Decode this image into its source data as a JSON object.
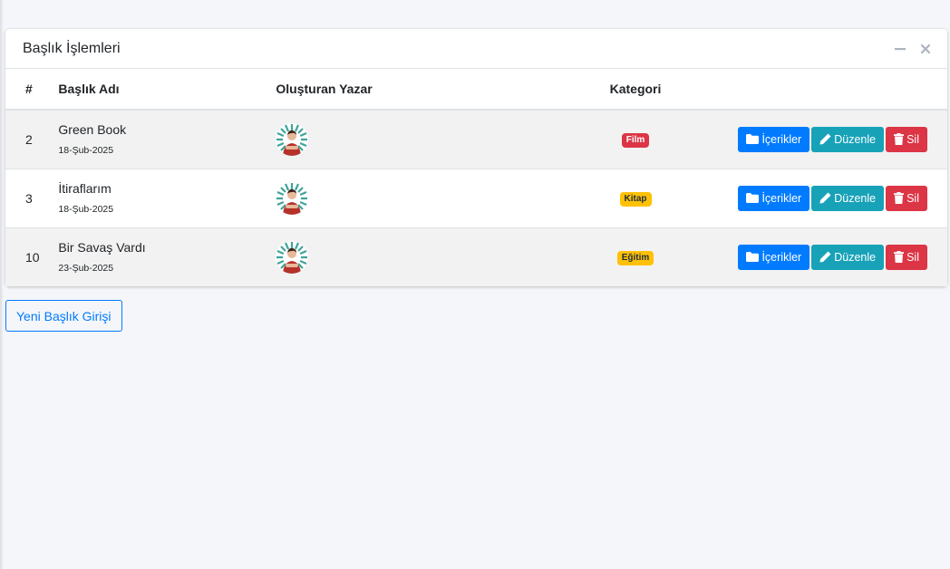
{
  "card": {
    "title": "Başlık İşlemleri",
    "tools": {
      "collapse_icon": "minus-icon",
      "remove_icon": "close-icon"
    }
  },
  "table": {
    "headers": {
      "num": "#",
      "title": "Başlık Adı",
      "author": "Oluşturan Yazar",
      "category": "Kategori"
    },
    "rows": [
      {
        "id": "2",
        "title": "Green Book",
        "date": "18-Şub-2025",
        "category": "Film",
        "category_style": "danger"
      },
      {
        "id": "3",
        "title": "İtiraflarım",
        "date": "18-Şub-2025",
        "category": "Kitap",
        "category_style": "warning"
      },
      {
        "id": "10",
        "title": "Bir Savaş Vardı",
        "date": "23-Şub-2025",
        "category": "Eğitim",
        "category_style": "warning"
      }
    ],
    "actions": {
      "contents": "İçerikler",
      "edit": "Düzenle",
      "delete": "Sil"
    }
  },
  "new_button": "Yeni Başlık Girişi",
  "colors": {
    "primary": "#007bff",
    "info": "#17a2b8",
    "danger": "#dc3545",
    "warning": "#ffc107"
  }
}
